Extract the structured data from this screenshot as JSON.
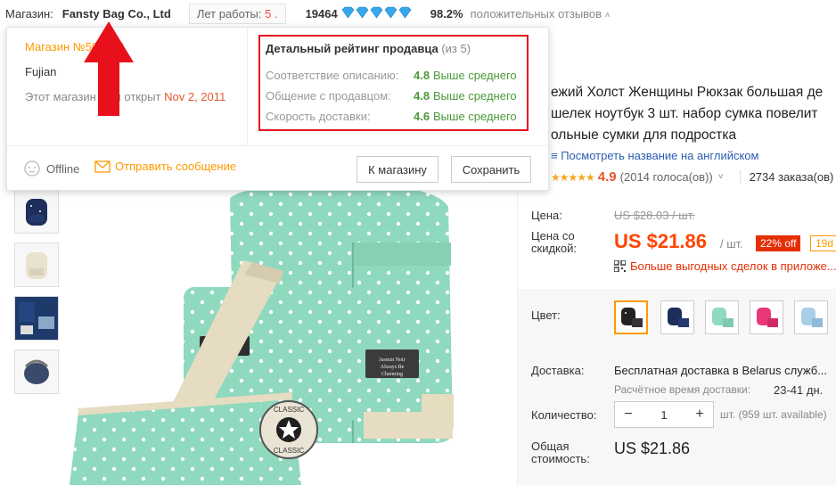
{
  "topbar": {
    "store_label": "Магазин:",
    "store_name": "Fansty Bag Co., Ltd",
    "years_label": "Лет работы:",
    "years_value": "5 .",
    "score": "19464",
    "diamonds": "♦♦♦♦♦",
    "feedback_pct": "98.2%",
    "feedback_text": "положительных отзывов",
    "feedback_chevron": "chevron-up"
  },
  "popup": {
    "store_number": "Магазин №503032",
    "province": "Fujian",
    "opened_prefix": "Этот магазин был открыт",
    "opened_date": "Nov 2, 2011",
    "rating_title": "Детальный рейтинг продавца",
    "rating_of": "(из 5)",
    "ratings": [
      {
        "label": "Соответствие описанию:",
        "value": "4.8",
        "desc": "Выше среднего"
      },
      {
        "label": "Общение с продавцом:",
        "value": "4.8",
        "desc": "Выше среднего"
      },
      {
        "label": "Скорость доставки:",
        "value": "4.6",
        "desc": "Выше среднего"
      }
    ],
    "status": "Offline",
    "message_link": "Отправить сообщение",
    "store_button": "К магазину",
    "save_button": "Сохранить"
  },
  "product": {
    "title": "...ежий Холст Женщины Рюкзак большая де... ...шелек ноутбук 3 шт. набор сумка повелит... ...ольные сумки для подростка",
    "translate_link": "Посмотреть название на английском",
    "rating": "4.9",
    "votes": "(2014 голоса(ов))",
    "orders": "2734 заказа(ов)"
  },
  "pricing": {
    "price_label": "Цена:",
    "old_price": "US $28.03 / шт.",
    "discount_label": "Цена со скидкой:",
    "new_price": "US $21.86",
    "per_unit": "/ шт.",
    "off_badge": "22% off",
    "days_badge": "19d",
    "qr_text": "Больше выгодных сделок в приложе..."
  },
  "options": {
    "color_label": "Цвет:",
    "delivery_label": "Доставка:",
    "delivery_text": "Бесплатная доставка в Belarus служб...",
    "eta_label": "Расчётное время доставки:",
    "eta_value": "23-41 дн.",
    "qty_label": "Количество:",
    "qty_value": "1",
    "qty_available": "шт. (959 шт. available)",
    "total_label": "Общая стоимость:",
    "total_value": "US $21.86"
  },
  "colors": {
    "accent": "#ff4400",
    "highlight_box": "#e4141e",
    "bag_mint": "#8fd9be"
  }
}
